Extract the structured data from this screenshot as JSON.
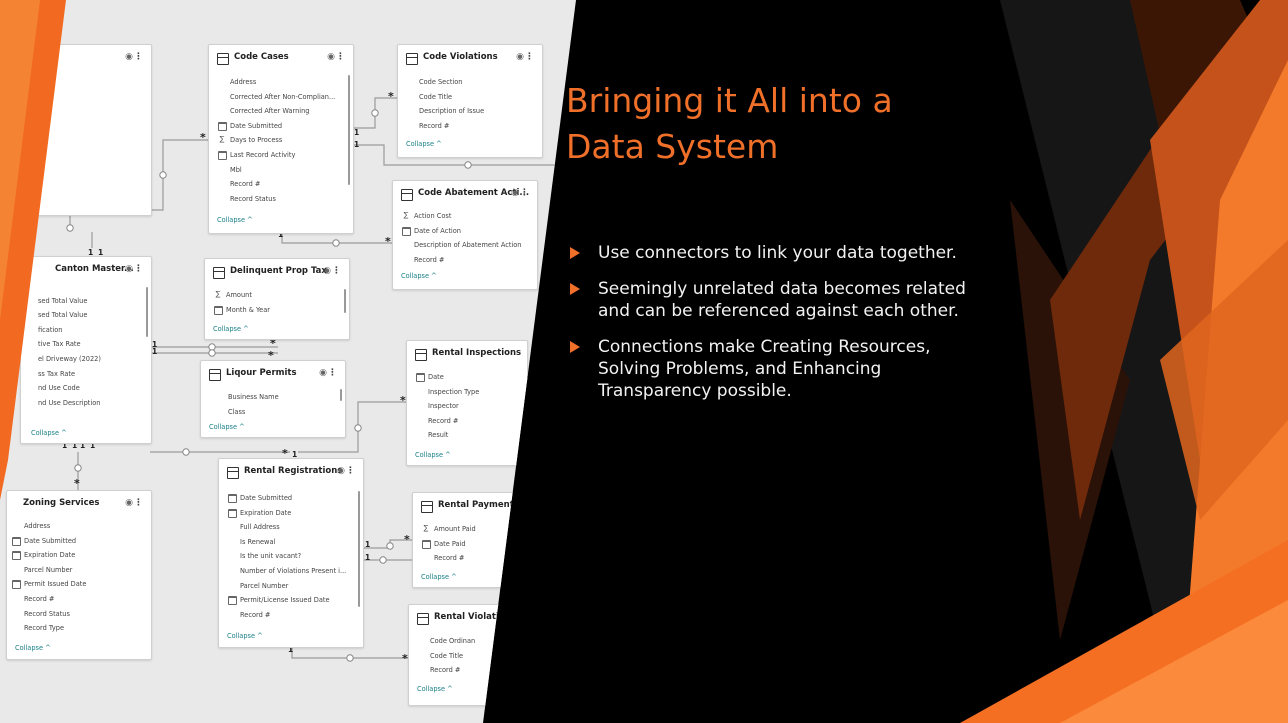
{
  "slide": {
    "title": "Bringing it All into a Data System",
    "bullets": [
      "Use connectors to link your data together.",
      "Seemingly unrelated data becomes related and can be referenced against each other.",
      "Connections make Creating Resources, Solving Problems, and Enhancing Transparency possible."
    ],
    "colors": {
      "accent": "#f0702a",
      "background": "#000000",
      "text": "#f2f2f2"
    }
  },
  "diagram": {
    "collapse_label": "Collapse ^",
    "tables": {
      "code_cases": {
        "title": "Code Cases",
        "fields": [
          {
            "icon": "",
            "name": "Address"
          },
          {
            "icon": "",
            "name": "Corrected After Non-Complian..."
          },
          {
            "icon": "",
            "name": "Corrected After Warning"
          },
          {
            "icon": "calendar-icon",
            "name": "Date Submitted"
          },
          {
            "icon": "sigma-icon",
            "name": "Days to Process"
          },
          {
            "icon": "calendar-icon",
            "name": "Last Record Activity"
          },
          {
            "icon": "",
            "name": "Mbl"
          },
          {
            "icon": "",
            "name": "Record #"
          },
          {
            "icon": "",
            "name": "Record Status"
          }
        ]
      },
      "code_violations": {
        "title": "Code Violations",
        "fields": [
          {
            "icon": "",
            "name": "Code Section"
          },
          {
            "icon": "",
            "name": "Code Title"
          },
          {
            "icon": "",
            "name": "Description of Issue"
          },
          {
            "icon": "",
            "name": "Record #"
          }
        ]
      },
      "code_abatement": {
        "title": "Code Abatement Acti...",
        "fields": [
          {
            "icon": "sigma-icon",
            "name": "Action Cost"
          },
          {
            "icon": "calendar-icon",
            "name": "Date of Action"
          },
          {
            "icon": "",
            "name": "Description of Abatement Action"
          },
          {
            "icon": "",
            "name": "Record #"
          }
        ]
      },
      "canton_master": {
        "title": "Canton Master...",
        "fields": [
          {
            "icon": "",
            "name": ""
          },
          {
            "icon": "",
            "name": "sed Total Value"
          },
          {
            "icon": "",
            "name": "sed Total Value"
          },
          {
            "icon": "",
            "name": "fication"
          },
          {
            "icon": "",
            "name": "tive Tax Rate"
          },
          {
            "icon": "",
            "name": "el Driveway (2022)"
          },
          {
            "icon": "",
            "name": "ss Tax Rate"
          },
          {
            "icon": "",
            "name": "nd Use Code"
          },
          {
            "icon": "",
            "name": "nd Use Description"
          }
        ]
      },
      "delinquent": {
        "title": "Delinquent Prop Tax",
        "fields": [
          {
            "icon": "sigma-icon",
            "name": "Amount"
          },
          {
            "icon": "calendar-icon",
            "name": "Month & Year"
          }
        ]
      },
      "liquor": {
        "title": "Liqour Permits",
        "fields": [
          {
            "icon": "",
            "name": "Business Name"
          },
          {
            "icon": "",
            "name": "Class"
          }
        ]
      },
      "rental_inspections": {
        "title": "Rental Inspections",
        "fields": [
          {
            "icon": "calendar-icon",
            "name": "Date"
          },
          {
            "icon": "",
            "name": "Inspection Type"
          },
          {
            "icon": "",
            "name": "Inspector"
          },
          {
            "icon": "",
            "name": "Record #"
          },
          {
            "icon": "",
            "name": "Result"
          }
        ]
      },
      "zoning": {
        "title": "Zoning Services",
        "fields": [
          {
            "icon": "",
            "name": "Address"
          },
          {
            "icon": "calendar-icon",
            "name": "Date Submitted"
          },
          {
            "icon": "calendar-icon",
            "name": "Expiration Date"
          },
          {
            "icon": "",
            "name": "Parcel Number"
          },
          {
            "icon": "calendar-icon",
            "name": "Permit Issued Date"
          },
          {
            "icon": "",
            "name": "Record #"
          },
          {
            "icon": "",
            "name": "Record Status"
          },
          {
            "icon": "",
            "name": "Record Type"
          }
        ]
      },
      "rental_registrations": {
        "title": "Rental Registrations",
        "fields": [
          {
            "icon": "calendar-icon",
            "name": "Date Submitted"
          },
          {
            "icon": "calendar-icon",
            "name": "Expiration Date"
          },
          {
            "icon": "",
            "name": "Full Address"
          },
          {
            "icon": "",
            "name": "Is Renewal"
          },
          {
            "icon": "",
            "name": "Is the unit vacant?"
          },
          {
            "icon": "",
            "name": "Number of Violations Present i..."
          },
          {
            "icon": "",
            "name": "Parcel Number"
          },
          {
            "icon": "calendar-icon",
            "name": "Permit/License Issued Date"
          },
          {
            "icon": "",
            "name": "Record #"
          }
        ]
      },
      "rental_payments": {
        "title": "Rental Payments",
        "fields": [
          {
            "icon": "sigma-icon",
            "name": "Amount Paid"
          },
          {
            "icon": "calendar-icon",
            "name": "Date Paid"
          },
          {
            "icon": "",
            "name": "Record #"
          }
        ]
      },
      "rental_violations": {
        "title": "Rental Violati",
        "fields": [
          {
            "icon": "",
            "name": "Code Ordinan"
          },
          {
            "icon": "",
            "name": "Code Title"
          },
          {
            "icon": "",
            "name": "Record #"
          }
        ]
      }
    },
    "cardinality": {
      "one": "1",
      "many": "*"
    }
  }
}
